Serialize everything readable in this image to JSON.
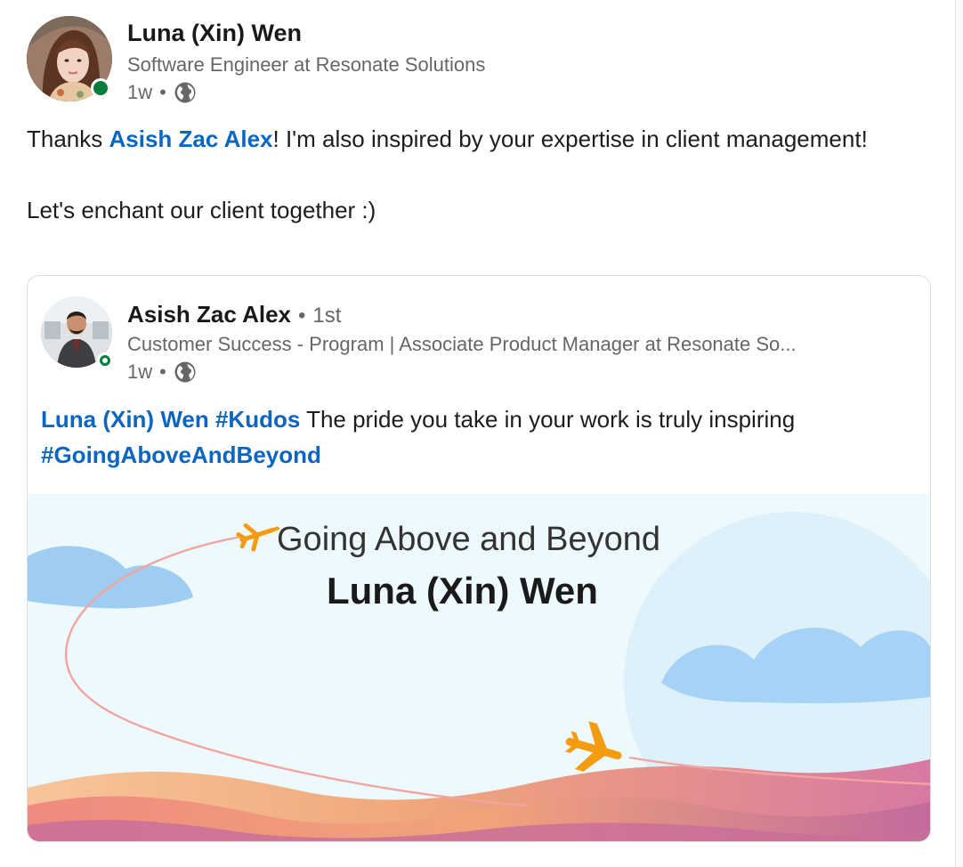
{
  "post": {
    "author": {
      "name": "Luna (Xin) Wen",
      "headline": "Software Engineer at Resonate Solutions",
      "time": "1w",
      "separator": "•",
      "visibility_icon": "globe-icon",
      "presence": "online"
    },
    "body": {
      "line1_prefix": "Thanks ",
      "mention": "Asish Zac Alex",
      "line1_suffix": "! I'm also inspired by your expertise in client management!",
      "line2": "Let's enchant our client together :)"
    }
  },
  "shared_post": {
    "author": {
      "name": "Asish Zac Alex",
      "separator": "•",
      "degree": "1st",
      "headline": "Customer Success - Program | Associate Product Manager at Resonate So...",
      "time": "1w",
      "visibility_icon": "globe-icon",
      "presence": "online"
    },
    "body": {
      "mention": "Luna (Xin) Wen",
      "hashtag1": "#Kudos",
      "text": " The pride you take in your work is truly inspiring",
      "hashtag2": "#GoingAboveAndBeyond"
    },
    "kudos_card": {
      "title": "Going Above and Beyond",
      "recipient": "Luna (Xin) Wen",
      "plane_icon": "airplane-icon"
    }
  },
  "colors": {
    "link": "#0a66c2",
    "presence": "#067d3c",
    "muted_text": "#666666",
    "plane": "#f39c12"
  }
}
